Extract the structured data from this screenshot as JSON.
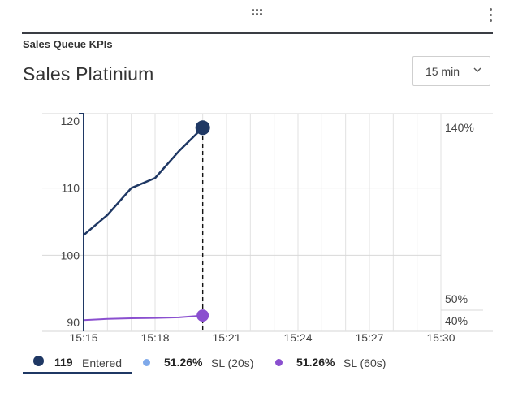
{
  "header": {
    "section_title": "Sales Queue KPIs",
    "widget_title": "Sales Platinium",
    "interval_label": "15 min"
  },
  "legend": [
    {
      "value": "119",
      "unit": "Entered",
      "color": "#1f3864"
    },
    {
      "value": "51.26%",
      "unit": "SL (20s)",
      "color": "#7fa9ea"
    },
    {
      "value": "51.26%",
      "unit": "SL (60s)",
      "color": "#8a4fcf"
    }
  ],
  "chart_data": {
    "type": "line",
    "x_ticks": [
      "15:15",
      "15:18",
      "15:21",
      "15:24",
      "15:27",
      "15:30"
    ],
    "y_left_ticks": [
      "90",
      "100",
      "110",
      "120"
    ],
    "y_right_ticks": [
      "40%",
      "50%",
      "140%"
    ],
    "ylim_left": [
      89,
      121
    ],
    "grid": true,
    "current_time": "15:20",
    "series": [
      {
        "name": "Entered",
        "color": "#1f3864",
        "axis": "left",
        "x": [
          "15:15",
          "15:16",
          "15:17",
          "15:18",
          "15:19",
          "15:20"
        ],
        "y": [
          103,
          106,
          110,
          111.5,
          115.5,
          119
        ]
      },
      {
        "name": "SL (60s)",
        "color": "#8a4fcf",
        "axis": "right",
        "x": [
          "15:15",
          "15:16",
          "15:17",
          "15:18",
          "15:19",
          "15:20"
        ],
        "y": [
          41,
          41.5,
          41.8,
          41.9,
          42.2,
          43
        ]
      }
    ]
  }
}
